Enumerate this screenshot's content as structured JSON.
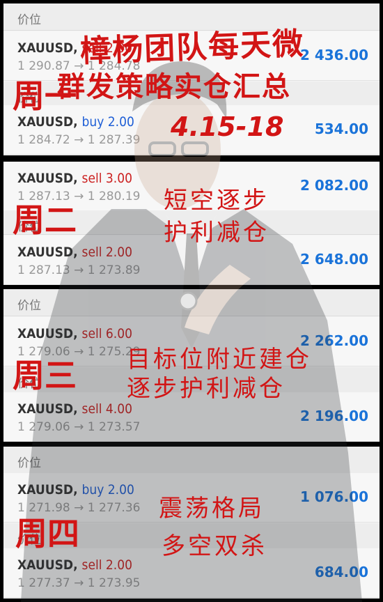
{
  "overlay": {
    "title_line1": "樟杨团队每天微",
    "title_line2": "群发策略实仓汇总",
    "date_range": "4.15-18",
    "day1": "周一",
    "day2": "周二",
    "day3": "周三",
    "day4": "周四",
    "note_tue_1": "短空逐步",
    "note_tue_2": "护利减仓",
    "note_wed_1": "目标位附近建仓",
    "note_wed_2": "逐步护利减仓",
    "note_thu_1": "震荡格局",
    "note_thu_2": "多空双杀"
  },
  "header_label": "价位",
  "trades": [
    {
      "symbol": "XAUUSD,",
      "side": "sell 2.00",
      "type": "sell",
      "from": "1 290.87",
      "to": "1 284.78",
      "profit": "2 436.00"
    },
    {
      "symbol": "XAUUSD,",
      "side": "buy 2.00",
      "type": "buy",
      "from": "1 284.72",
      "to": "1 287.39",
      "profit": "534.00"
    },
    {
      "symbol": "XAUUSD,",
      "side": "sell 3.00",
      "type": "sell",
      "from": "1 287.13",
      "to": "1 280.19",
      "profit": "2 082.00"
    },
    {
      "symbol": "XAUUSD,",
      "side": "sell 2.00",
      "type": "sell",
      "from": "1 287.13",
      "to": "1 273.89",
      "profit": "2 648.00"
    },
    {
      "symbol": "XAUUSD,",
      "side": "sell 6.00",
      "type": "sell",
      "from": "1 279.06",
      "to": "1 275.29",
      "profit": "2 262.00"
    },
    {
      "symbol": "XAUUSD,",
      "side": "sell 4.00",
      "type": "sell",
      "from": "1 279.06",
      "to": "1 273.57",
      "profit": "2 196.00"
    },
    {
      "symbol": "XAUUSD,",
      "side": "buy 2.00",
      "type": "buy",
      "from": "1 271.98",
      "to": "1 277.36",
      "profit": "1 076.00"
    },
    {
      "symbol": "XAUUSD,",
      "side": "sell 2.00",
      "type": "sell",
      "from": "1 277.37",
      "to": "1 273.95",
      "profit": "684.00"
    }
  ],
  "arrow": "→",
  "colors": {
    "sell": "#cc2222",
    "buy": "#1f5fd6",
    "profit": "#1a73d9",
    "overlay_text": "#d21515"
  }
}
